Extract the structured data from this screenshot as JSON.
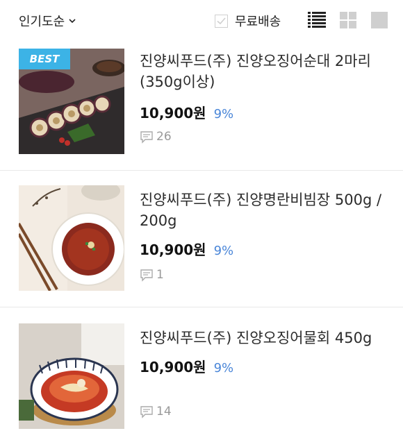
{
  "toolbar": {
    "sort_label": "인기도순",
    "free_shipping_label": "무료배송",
    "free_shipping_checked": false,
    "view_modes": [
      "list-detail-icon",
      "grid-icon",
      "single-icon"
    ],
    "active_view": "list-detail-icon"
  },
  "products": [
    {
      "title": "진양씨푸드(주) 진양오징어순대 2마리 (350g이상)",
      "price": "10,900원",
      "discount": "9%",
      "reviews": "26",
      "badge": "BEST"
    },
    {
      "title": "진양씨푸드(주) 진양명란비빔장 500g / 200g",
      "price": "10,900원",
      "discount": "9%",
      "reviews": "1",
      "badge": ""
    },
    {
      "title": "진양씨푸드(주) 진양오징어물회 450g",
      "price": "10,900원",
      "discount": "9%",
      "reviews": "14",
      "badge": ""
    }
  ],
  "colors": {
    "discount": "#4a86d8",
    "badge": "#3cb3e6",
    "divider": "#e8e8e8"
  }
}
